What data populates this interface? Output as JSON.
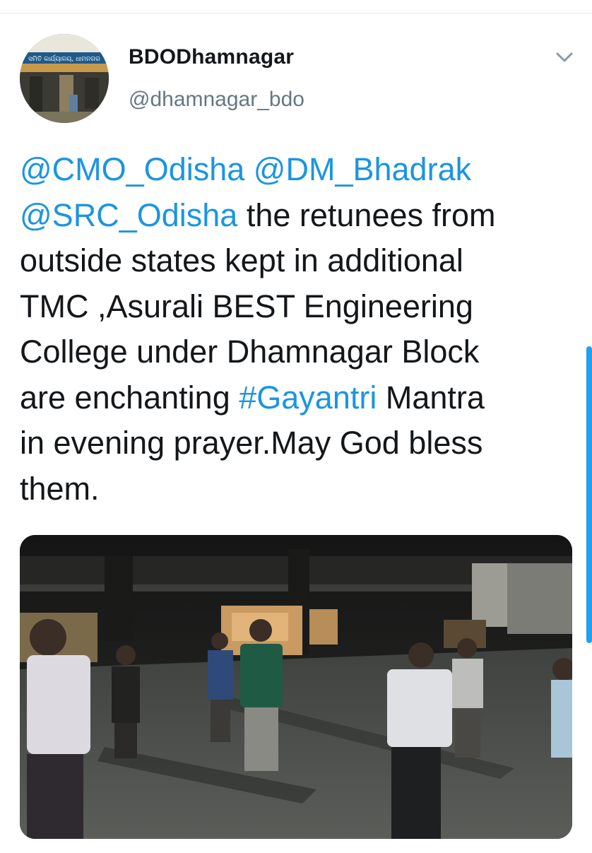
{
  "tweet": {
    "display_name": "BDODhamnagar",
    "handle": "@dhamnagar_bdo",
    "avatar_sign_text": "ସମିତି କାର୍ଯ୍ୟାଳୟ, ଧାମନଗର",
    "text": {
      "mention_cmo": "@CMO_Odisha",
      "mention_dm": "@DM_Bhadrak",
      "mention_src": "@SRC_Odisha",
      "seg_1": " the retunees from",
      "line_3": "outside states kept in additional",
      "line_4": "TMC ,Asurali BEST Engineering",
      "line_5": "College under Dhamnagar Block",
      "seg_6a": "are enchanting ",
      "hashtag": "#Gayantri",
      "seg_6b": " Mantra",
      "line_7": "in evening prayer.May God bless",
      "line_8": "them."
    },
    "media": {
      "type": "video-thumbnail"
    }
  },
  "icons": {
    "caret": "chevron-down-icon"
  },
  "colors": {
    "link": "#1b95e0",
    "text": "#14171a",
    "secondary": "#657786",
    "scrollbar": "#1da1f2"
  }
}
